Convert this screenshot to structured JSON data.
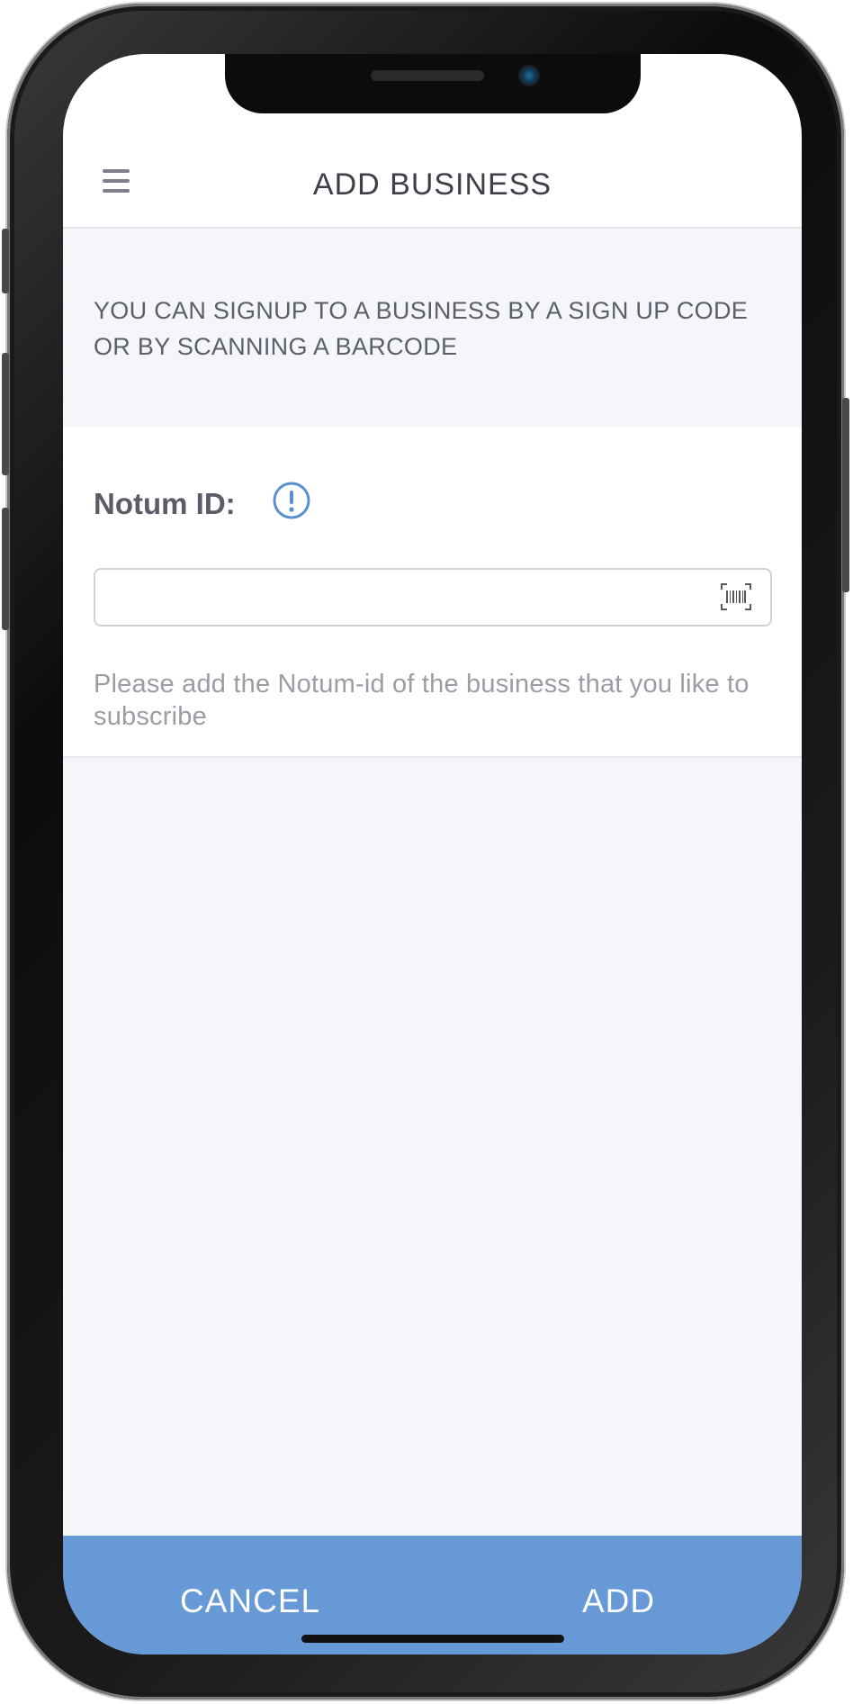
{
  "header": {
    "title": "ADD BUSINESS",
    "menu_icon": "hamburger-menu-icon"
  },
  "info_banner": {
    "text": "YOU CAN SIGNUP TO A BUSINESS BY A SIGN UP CODE\nOR BY SCANNING A BARCODE"
  },
  "form": {
    "label": "Notum ID:",
    "info_icon": "exclamation-circle-icon",
    "input_value": "",
    "input_placeholder": "",
    "scan_icon": "barcode-scan-icon",
    "helper_text": "Please add the Notum-id of the business that you like to subscribe"
  },
  "actions": {
    "cancel_label": "CANCEL",
    "add_label": "ADD"
  },
  "colors": {
    "accent": "#6699d6",
    "info_icon": "#5b8fd0",
    "screen_background": "#f4f6fa",
    "title_text": "#3d4049"
  }
}
